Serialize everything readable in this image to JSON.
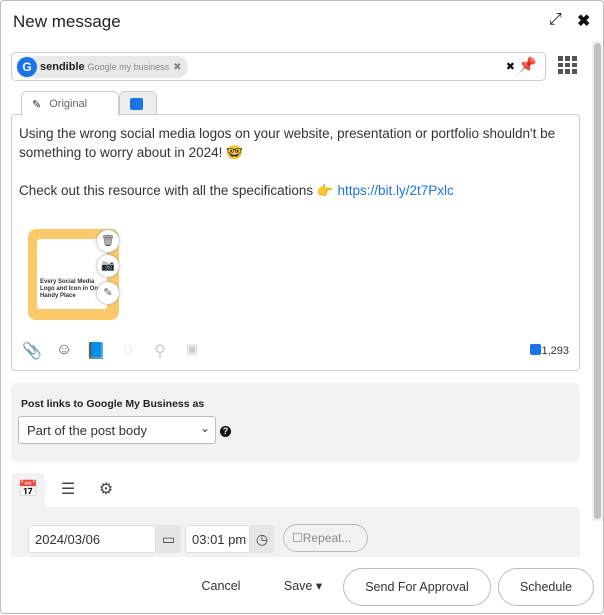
{
  "header": {
    "title": "New message",
    "expand_icon": "expand-arrows-icon",
    "close_icon": "close-x-icon"
  },
  "account": {
    "avatar_letter": "G",
    "name": "sendible",
    "service": "Google my business",
    "remove": "✖",
    "clear": "✖",
    "pin": "pin-icon",
    "grid": "grid-icon"
  },
  "tabs": {
    "original": "Original",
    "gmb": "google-my-business-icon"
  },
  "editor": {
    "line1": "Using the wrong social media logos on your website, presentation or portfolio shouldn't be something to worry about in 2024! 🤓",
    "line2": "Check out this resource with all the specifications 👉 ",
    "link": "https://bit.ly/2t7Pxlc",
    "image_text": "Every Social Media Logo and Icon in One Handy Place",
    "char_count": "1,293"
  },
  "gmb": {
    "label": "Post links to Google My Business as",
    "selected": "Part of the post body"
  },
  "schedule": {
    "date": "2024/03/06",
    "time": "03:01 pm",
    "repeat": "Repeat..."
  },
  "footer": {
    "cancel": "Cancel",
    "save": "Save",
    "approval": "Send For Approval",
    "schedule": "Schedule"
  }
}
